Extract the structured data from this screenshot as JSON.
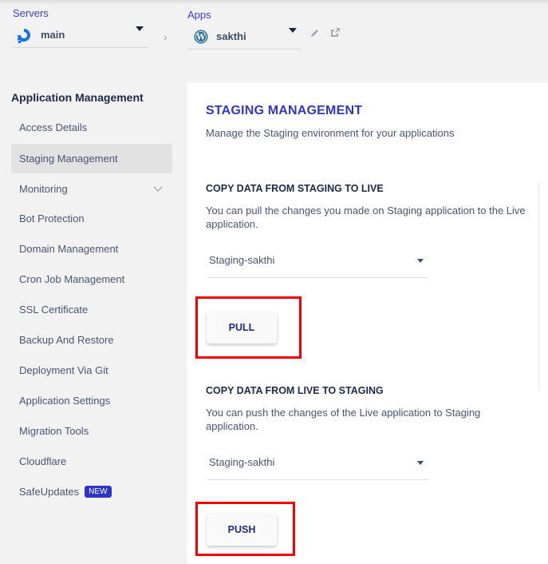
{
  "header": {
    "servers_label": "Servers",
    "server_name": "main",
    "server_icon": "digitalocean-icon",
    "apps_label": "Apps",
    "app_name": "sakthi",
    "app_icon": "wordpress-icon",
    "edit_icon": "pencil-icon",
    "open_icon": "external-link-icon"
  },
  "sidebar": {
    "title": "Application Management",
    "items": [
      {
        "label": "Access Details"
      },
      {
        "label": "Staging Management",
        "active": true
      },
      {
        "label": "Monitoring",
        "expandable": true
      },
      {
        "label": "Bot Protection"
      },
      {
        "label": "Domain Management"
      },
      {
        "label": "Cron Job Management"
      },
      {
        "label": "SSL Certificate"
      },
      {
        "label": "Backup And Restore"
      },
      {
        "label": "Deployment Via Git"
      },
      {
        "label": "Application Settings"
      },
      {
        "label": "Migration Tools"
      },
      {
        "label": "Cloudflare"
      },
      {
        "label": "SafeUpdates",
        "badge": "NEW"
      }
    ]
  },
  "main": {
    "title": "STAGING MANAGEMENT",
    "subtitle": "Manage the Staging environment for your applications",
    "sections": [
      {
        "title": "COPY DATA FROM STAGING TO LIVE",
        "description": "You can pull the changes you made on Staging application to the Live application.",
        "select_value": "Staging-sakthi",
        "button_label": "PULL"
      },
      {
        "title": "COPY DATA FROM LIVE TO STAGING",
        "description": "You can push the changes of the Live application to Staging application.",
        "select_value": "Staging-sakthi",
        "button_label": "PUSH"
      }
    ]
  },
  "colors": {
    "accent": "#3236c4",
    "highlight": "#f40000",
    "badge": "#2e35c6"
  }
}
